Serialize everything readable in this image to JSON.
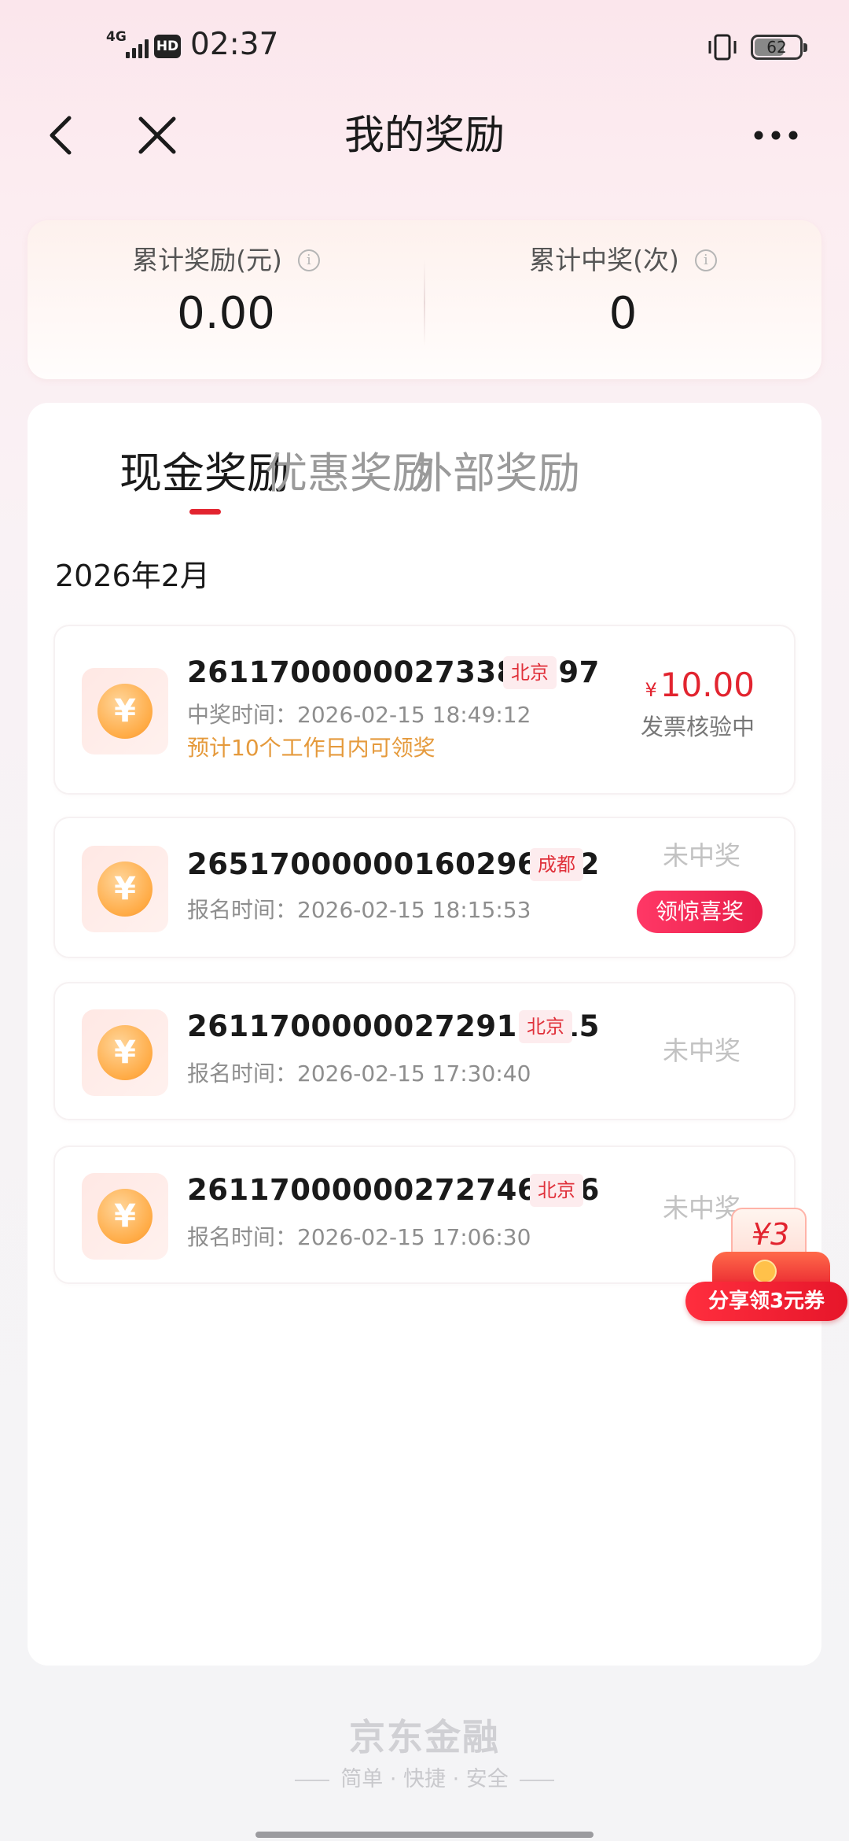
{
  "status_bar": {
    "network": "4G",
    "hd": "HD",
    "time": "02:37",
    "battery": "62",
    "icons": [
      "signal-icon",
      "hd-icon",
      "vibrate-icon",
      "battery-icon"
    ]
  },
  "nav": {
    "title": "我的奖励",
    "icons": [
      "back-arrow-icon",
      "close-icon",
      "more-dots-icon"
    ]
  },
  "summary": {
    "left": {
      "label": "累计奖励(元)",
      "value": "0.00"
    },
    "right": {
      "label": "累计中奖(次)",
      "value": "0"
    },
    "info_glyph": "i"
  },
  "tabs": [
    {
      "label": "现金奖励",
      "active": true
    },
    {
      "label": "优惠奖励",
      "active": false
    },
    {
      "label": "外部奖励",
      "active": false
    }
  ],
  "month": "2026年2月",
  "records": [
    {
      "id": "26117000000273385697",
      "city": "北京",
      "time": "中奖时间：2026-02-15 18:49:12",
      "note": "预计10个工作日内可领奖",
      "currency": "¥",
      "amount": "10.00",
      "status": "发票核验中"
    },
    {
      "id": "26517000000160296662",
      "city": "成都",
      "time": "报名时间：2026-02-15 18:15:53",
      "status": "未中奖",
      "button": "领惊喜奖"
    },
    {
      "id": "26117000000272916715",
      "city": "北京",
      "time": "报名时间：2026-02-15 17:30:40",
      "status": "未中奖"
    },
    {
      "id": "26117000000272746226",
      "city": "北京",
      "time": "报名时间：2026-02-15 17:06:30",
      "status": "未中奖"
    }
  ],
  "coin_glyph": "¥",
  "share": {
    "packet_label": "¥3",
    "button": "分享领3元券"
  },
  "footer": {
    "brand": "京东金融",
    "slogan": "简单 · 快捷 · 安全"
  },
  "colors": {
    "accent_red": "#e2242f",
    "note_orange": "#e59a3c",
    "city_tag_bg": "#fdecee"
  }
}
